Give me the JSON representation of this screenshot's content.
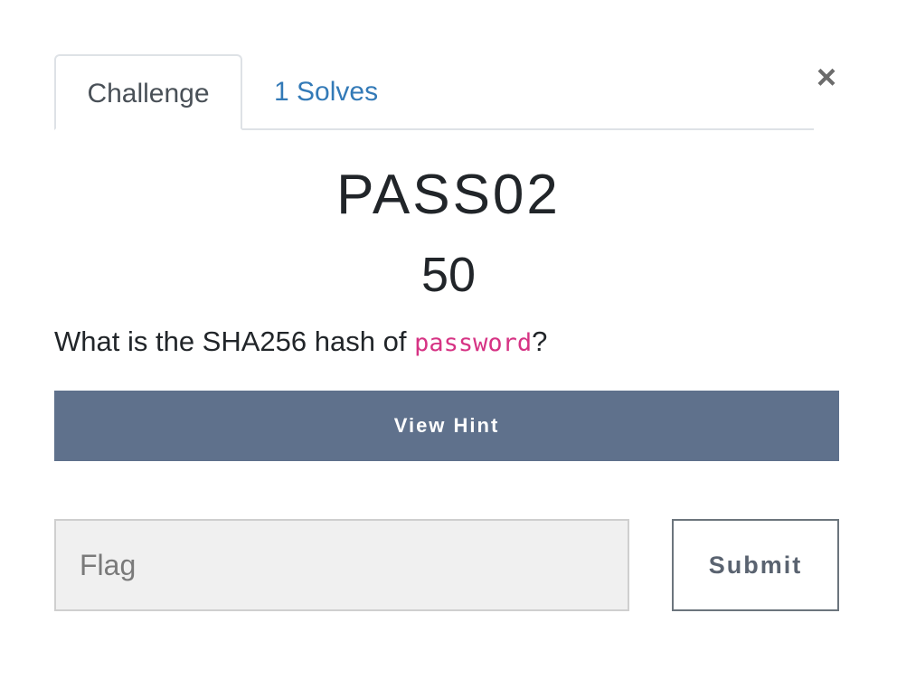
{
  "modal": {
    "close_symbol": "×",
    "tabs": [
      {
        "label": "Challenge",
        "active": true
      },
      {
        "label": "1 Solves",
        "active": false
      }
    ],
    "challenge": {
      "name": "PASS02",
      "points": "50",
      "description_prefix": "What is the SHA256 hash of ",
      "description_code": "password",
      "description_suffix": "?"
    },
    "hint_button_label": "View Hint",
    "flag_input": {
      "placeholder": "Flag",
      "value": ""
    },
    "submit_label": "Submit",
    "colors": {
      "hint_button_bg": "#5f718c",
      "link": "#337ab7",
      "code": "#d63384"
    }
  }
}
